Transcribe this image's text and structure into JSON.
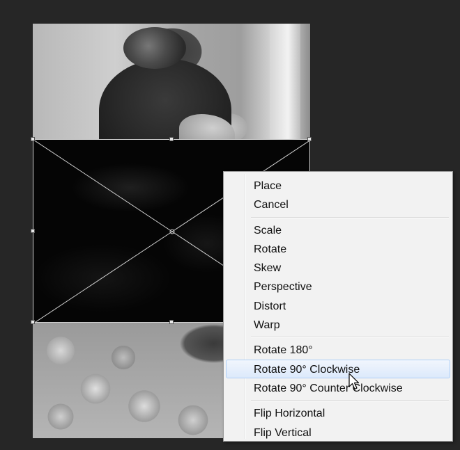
{
  "context_menu": {
    "groups": [
      [
        "Place",
        "Cancel"
      ],
      [
        "Scale",
        "Rotate",
        "Skew",
        "Perspective",
        "Distort",
        "Warp"
      ],
      [
        "Rotate 180°",
        "Rotate 90° Clockwise",
        "Rotate 90° Counter Clockwise"
      ],
      [
        "Flip Horizontal",
        "Flip Vertical"
      ]
    ],
    "hovered_item": "Rotate 90° Clockwise"
  },
  "colors": {
    "workspace_bg": "#262626",
    "menu_bg": "#f2f2f2",
    "menu_hover_border": "#aecff7"
  },
  "icons": {
    "cursor": "arrow-cursor-icon"
  }
}
